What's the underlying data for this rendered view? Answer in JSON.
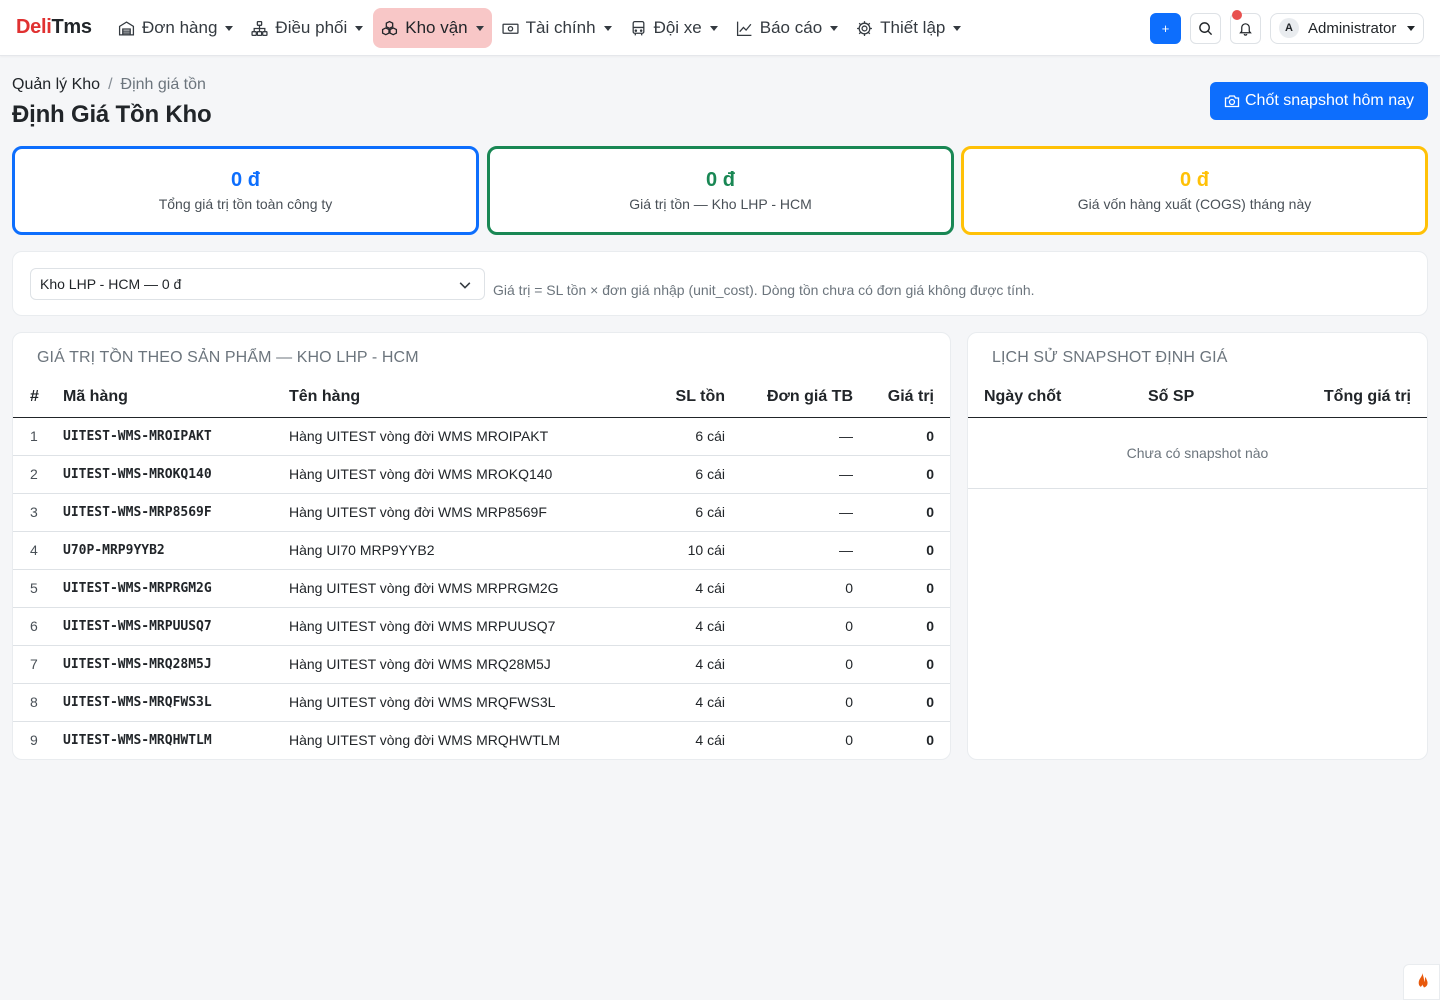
{
  "brand": {
    "part1": "Deli",
    "part2": "Tms"
  },
  "nav": [
    {
      "label": "Đơn hàng",
      "icon": "warehouse-icon",
      "active": false
    },
    {
      "label": "Điều phối",
      "icon": "hierarchy-icon",
      "active": false
    },
    {
      "label": "Kho vận",
      "icon": "boxes-icon",
      "active": true
    },
    {
      "label": "Tài chính",
      "icon": "cash-icon",
      "active": false
    },
    {
      "label": "Đội xe",
      "icon": "bus-icon",
      "active": false
    },
    {
      "label": "Báo cáo",
      "icon": "chart-line-icon",
      "active": false
    },
    {
      "label": "Thiết lập",
      "icon": "gear-icon",
      "active": false
    }
  ],
  "topbar": {
    "add_label": "+",
    "user_initial": "A",
    "user_name": "Administrator"
  },
  "breadcrumb": {
    "parent": "Quản lý Kho",
    "separator": "/",
    "current": "Định giá tồn"
  },
  "page_title": "Định Giá Tồn Kho",
  "snapshot_button": "Chốt snapshot hôm nay",
  "stats": [
    {
      "value": "0 đ",
      "label": "Tổng giá trị tồn toàn công ty",
      "color": "#0d6efd"
    },
    {
      "value": "0 đ",
      "label": "Giá trị tồn — Kho LHP - HCM",
      "color": "#198754"
    },
    {
      "value": "0 đ",
      "label": "Giá vốn hàng xuất (COGS) tháng này",
      "color": "#ffc107"
    }
  ],
  "filter": {
    "selected": "Kho LHP - HCM — 0 đ",
    "hint": "Giá trị = SL tồn × đơn giá nhập (unit_cost). Dòng tồn chưa có đơn giá không được tính."
  },
  "products": {
    "title": "GIÁ TRỊ TỒN THEO SẢN PHẨM — KHO LHP - HCM",
    "columns": [
      "#",
      "Mã hàng",
      "Tên hàng",
      "SL tồn",
      "Đơn giá TB",
      "Giá trị"
    ],
    "rows": [
      {
        "no": "1",
        "code": "UITEST-WMS-MROIPAKT",
        "name": "Hàng UITEST vòng đời WMS MROIPAKT",
        "qty": "6 cái",
        "price": "—",
        "value": "0"
      },
      {
        "no": "2",
        "code": "UITEST-WMS-MROKQ140",
        "name": "Hàng UITEST vòng đời WMS MROKQ140",
        "qty": "6 cái",
        "price": "—",
        "value": "0"
      },
      {
        "no": "3",
        "code": "UITEST-WMS-MRP8569F",
        "name": "Hàng UITEST vòng đời WMS MRP8569F",
        "qty": "6 cái",
        "price": "—",
        "value": "0"
      },
      {
        "no": "4",
        "code": "U70P-MRP9YYB2",
        "name": "Hàng UI70 MRP9YYB2",
        "qty": "10 cái",
        "price": "—",
        "value": "0"
      },
      {
        "no": "5",
        "code": "UITEST-WMS-MRPRGM2G",
        "name": "Hàng UITEST vòng đời WMS MRPRGM2G",
        "qty": "4 cái",
        "price": "0",
        "value": "0"
      },
      {
        "no": "6",
        "code": "UITEST-WMS-MRPUUSQ7",
        "name": "Hàng UITEST vòng đời WMS MRPUUSQ7",
        "qty": "4 cái",
        "price": "0",
        "value": "0"
      },
      {
        "no": "7",
        "code": "UITEST-WMS-MRQ28M5J",
        "name": "Hàng UITEST vòng đời WMS MRQ28M5J",
        "qty": "4 cái",
        "price": "0",
        "value": "0"
      },
      {
        "no": "8",
        "code": "UITEST-WMS-MRQFWS3L",
        "name": "Hàng UITEST vòng đời WMS MRQFWS3L",
        "qty": "4 cái",
        "price": "0",
        "value": "0"
      },
      {
        "no": "9",
        "code": "UITEST-WMS-MRQHWTLM",
        "name": "Hàng UITEST vòng đời WMS MRQHWTLM",
        "qty": "4 cái",
        "price": "0",
        "value": "0"
      }
    ]
  },
  "snapshots": {
    "title": "LỊCH SỬ SNAPSHOT ĐỊNH GIÁ",
    "columns": [
      "Ngày chốt",
      "Số SP",
      "Tổng giá trị"
    ],
    "empty": "Chưa có snapshot nào"
  }
}
